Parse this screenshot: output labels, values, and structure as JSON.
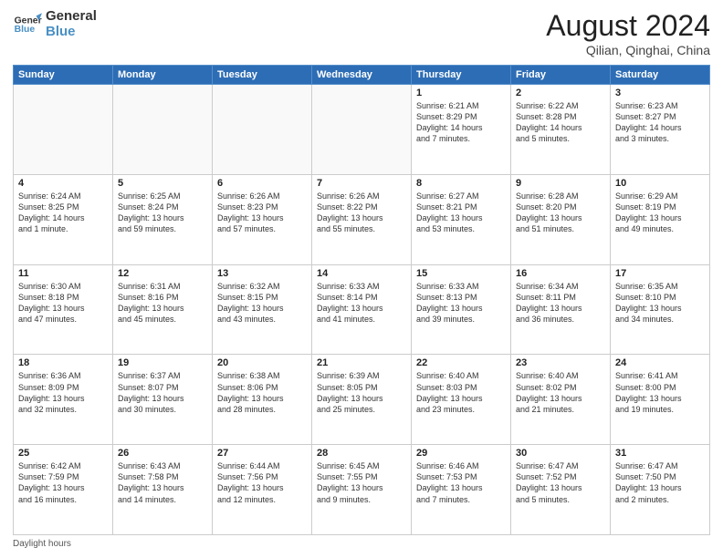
{
  "header": {
    "logo_line1": "General",
    "logo_line2": "Blue",
    "month_year": "August 2024",
    "location": "Qilian, Qinghai, China"
  },
  "weekdays": [
    "Sunday",
    "Monday",
    "Tuesday",
    "Wednesday",
    "Thursday",
    "Friday",
    "Saturday"
  ],
  "weeks": [
    [
      {
        "day": "",
        "info": ""
      },
      {
        "day": "",
        "info": ""
      },
      {
        "day": "",
        "info": ""
      },
      {
        "day": "",
        "info": ""
      },
      {
        "day": "1",
        "info": "Sunrise: 6:21 AM\nSunset: 8:29 PM\nDaylight: 14 hours\nand 7 minutes."
      },
      {
        "day": "2",
        "info": "Sunrise: 6:22 AM\nSunset: 8:28 PM\nDaylight: 14 hours\nand 5 minutes."
      },
      {
        "day": "3",
        "info": "Sunrise: 6:23 AM\nSunset: 8:27 PM\nDaylight: 14 hours\nand 3 minutes."
      }
    ],
    [
      {
        "day": "4",
        "info": "Sunrise: 6:24 AM\nSunset: 8:25 PM\nDaylight: 14 hours\nand 1 minute."
      },
      {
        "day": "5",
        "info": "Sunrise: 6:25 AM\nSunset: 8:24 PM\nDaylight: 13 hours\nand 59 minutes."
      },
      {
        "day": "6",
        "info": "Sunrise: 6:26 AM\nSunset: 8:23 PM\nDaylight: 13 hours\nand 57 minutes."
      },
      {
        "day": "7",
        "info": "Sunrise: 6:26 AM\nSunset: 8:22 PM\nDaylight: 13 hours\nand 55 minutes."
      },
      {
        "day": "8",
        "info": "Sunrise: 6:27 AM\nSunset: 8:21 PM\nDaylight: 13 hours\nand 53 minutes."
      },
      {
        "day": "9",
        "info": "Sunrise: 6:28 AM\nSunset: 8:20 PM\nDaylight: 13 hours\nand 51 minutes."
      },
      {
        "day": "10",
        "info": "Sunrise: 6:29 AM\nSunset: 8:19 PM\nDaylight: 13 hours\nand 49 minutes."
      }
    ],
    [
      {
        "day": "11",
        "info": "Sunrise: 6:30 AM\nSunset: 8:18 PM\nDaylight: 13 hours\nand 47 minutes."
      },
      {
        "day": "12",
        "info": "Sunrise: 6:31 AM\nSunset: 8:16 PM\nDaylight: 13 hours\nand 45 minutes."
      },
      {
        "day": "13",
        "info": "Sunrise: 6:32 AM\nSunset: 8:15 PM\nDaylight: 13 hours\nand 43 minutes."
      },
      {
        "day": "14",
        "info": "Sunrise: 6:33 AM\nSunset: 8:14 PM\nDaylight: 13 hours\nand 41 minutes."
      },
      {
        "day": "15",
        "info": "Sunrise: 6:33 AM\nSunset: 8:13 PM\nDaylight: 13 hours\nand 39 minutes."
      },
      {
        "day": "16",
        "info": "Sunrise: 6:34 AM\nSunset: 8:11 PM\nDaylight: 13 hours\nand 36 minutes."
      },
      {
        "day": "17",
        "info": "Sunrise: 6:35 AM\nSunset: 8:10 PM\nDaylight: 13 hours\nand 34 minutes."
      }
    ],
    [
      {
        "day": "18",
        "info": "Sunrise: 6:36 AM\nSunset: 8:09 PM\nDaylight: 13 hours\nand 32 minutes."
      },
      {
        "day": "19",
        "info": "Sunrise: 6:37 AM\nSunset: 8:07 PM\nDaylight: 13 hours\nand 30 minutes."
      },
      {
        "day": "20",
        "info": "Sunrise: 6:38 AM\nSunset: 8:06 PM\nDaylight: 13 hours\nand 28 minutes."
      },
      {
        "day": "21",
        "info": "Sunrise: 6:39 AM\nSunset: 8:05 PM\nDaylight: 13 hours\nand 25 minutes."
      },
      {
        "day": "22",
        "info": "Sunrise: 6:40 AM\nSunset: 8:03 PM\nDaylight: 13 hours\nand 23 minutes."
      },
      {
        "day": "23",
        "info": "Sunrise: 6:40 AM\nSunset: 8:02 PM\nDaylight: 13 hours\nand 21 minutes."
      },
      {
        "day": "24",
        "info": "Sunrise: 6:41 AM\nSunset: 8:00 PM\nDaylight: 13 hours\nand 19 minutes."
      }
    ],
    [
      {
        "day": "25",
        "info": "Sunrise: 6:42 AM\nSunset: 7:59 PM\nDaylight: 13 hours\nand 16 minutes."
      },
      {
        "day": "26",
        "info": "Sunrise: 6:43 AM\nSunset: 7:58 PM\nDaylight: 13 hours\nand 14 minutes."
      },
      {
        "day": "27",
        "info": "Sunrise: 6:44 AM\nSunset: 7:56 PM\nDaylight: 13 hours\nand 12 minutes."
      },
      {
        "day": "28",
        "info": "Sunrise: 6:45 AM\nSunset: 7:55 PM\nDaylight: 13 hours\nand 9 minutes."
      },
      {
        "day": "29",
        "info": "Sunrise: 6:46 AM\nSunset: 7:53 PM\nDaylight: 13 hours\nand 7 minutes."
      },
      {
        "day": "30",
        "info": "Sunrise: 6:47 AM\nSunset: 7:52 PM\nDaylight: 13 hours\nand 5 minutes."
      },
      {
        "day": "31",
        "info": "Sunrise: 6:47 AM\nSunset: 7:50 PM\nDaylight: 13 hours\nand 2 minutes."
      }
    ]
  ],
  "footer": {
    "label": "Daylight hours"
  }
}
